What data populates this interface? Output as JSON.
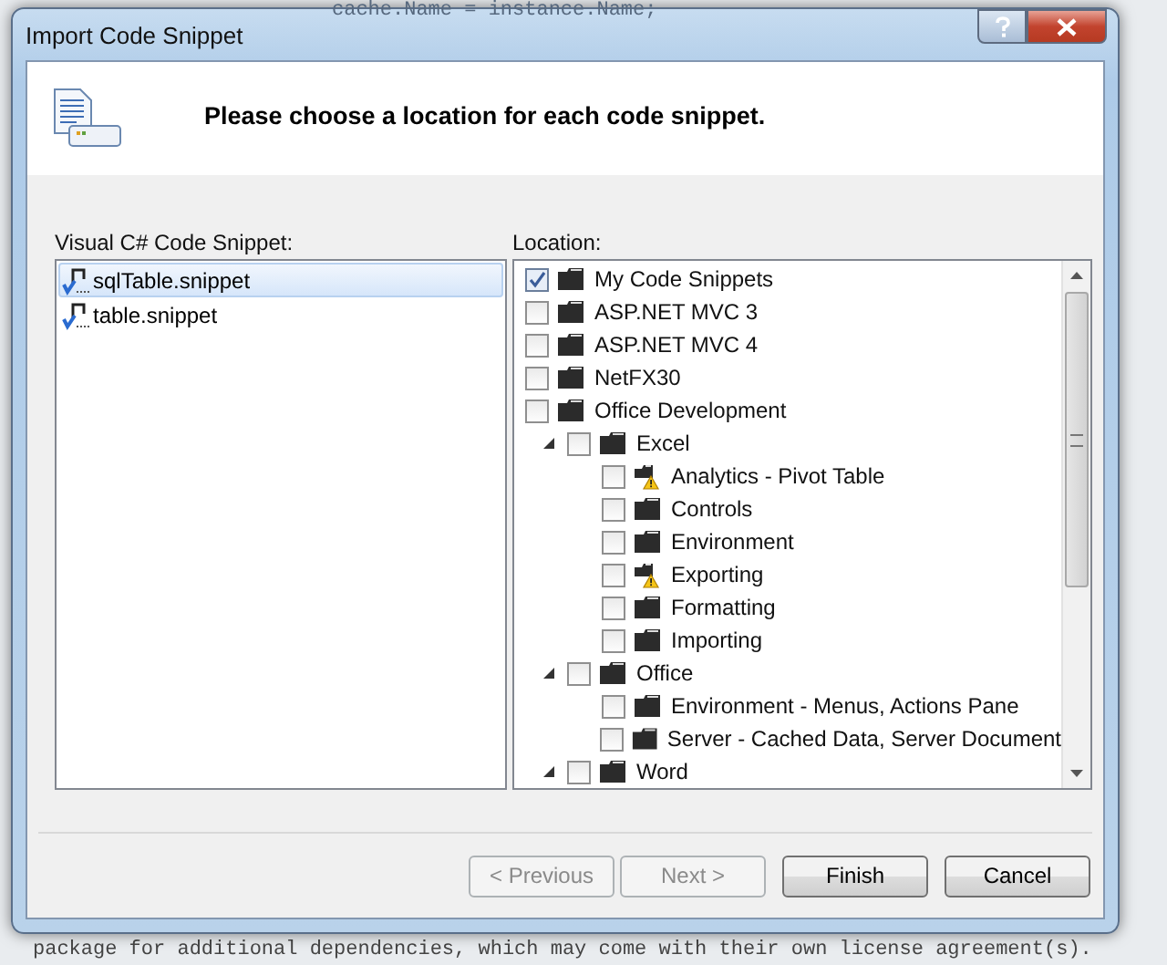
{
  "background_code": {
    "top_line": "cache.Name = instance.Name;",
    "bottom_line": "package for additional dependencies, which may come with their own license agreement(s)."
  },
  "window": {
    "title": "Import Code Snippet",
    "heading": "Please choose a location for each code snippet."
  },
  "snippets": {
    "label": "Visual C# Code Snippet:",
    "items": [
      {
        "name": "sqlTable.snippet",
        "selected": true
      },
      {
        "name": "table.snippet",
        "selected": false
      }
    ]
  },
  "locations": {
    "label": "Location:",
    "items": [
      {
        "name": "My Code Snippets",
        "checked": true
      },
      {
        "name": "ASP.NET MVC 3",
        "checked": false
      },
      {
        "name": "ASP.NET MVC 4",
        "checked": false
      },
      {
        "name": "NetFX30",
        "checked": false
      },
      {
        "name": "Office Development",
        "checked": false,
        "children": [
          {
            "name": "Excel",
            "checked": false,
            "expanded": true,
            "children": [
              {
                "name": "Analytics - Pivot Table",
                "checked": false,
                "warning": true
              },
              {
                "name": "Controls",
                "checked": false
              },
              {
                "name": "Environment",
                "checked": false
              },
              {
                "name": "Exporting",
                "checked": false,
                "warning": true
              },
              {
                "name": "Formatting",
                "checked": false
              },
              {
                "name": "Importing",
                "checked": false
              }
            ]
          },
          {
            "name": "Office",
            "checked": false,
            "expanded": true,
            "children": [
              {
                "name": "Environment - Menus, Actions Pane",
                "checked": false
              },
              {
                "name": "Server - Cached Data, Server Document",
                "checked": false
              }
            ]
          },
          {
            "name": "Word",
            "checked": false,
            "expanded": true
          }
        ]
      }
    ]
  },
  "buttons": [
    {
      "label": "< Previous",
      "disabled": true
    },
    {
      "label": "Next >",
      "disabled": true
    },
    {
      "label": "Finish",
      "disabled": false
    },
    {
      "label": "Cancel",
      "disabled": false
    }
  ]
}
